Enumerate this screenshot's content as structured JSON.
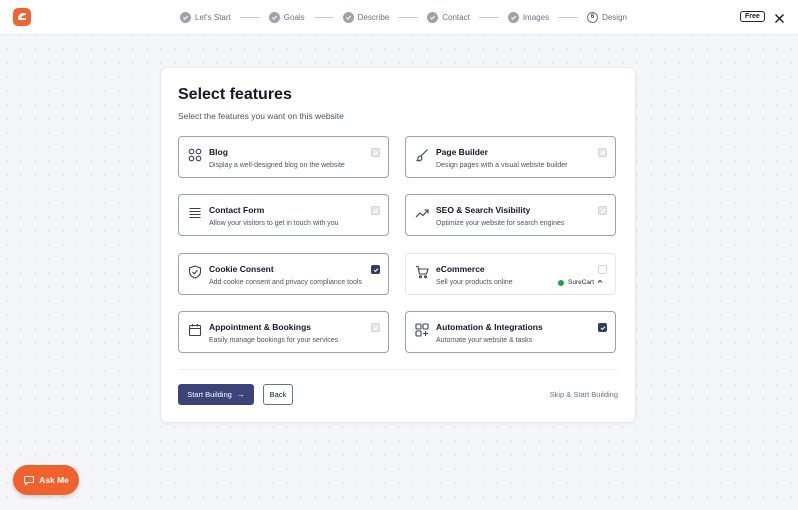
{
  "header": {
    "steps": [
      {
        "label": "Let's Start",
        "state": "done"
      },
      {
        "label": "Goals",
        "state": "done"
      },
      {
        "label": "Describe",
        "state": "done"
      },
      {
        "label": "Contact",
        "state": "done"
      },
      {
        "label": "Images",
        "state": "done"
      },
      {
        "label": "Design",
        "state": "current",
        "number": "6"
      }
    ],
    "badge": "Free"
  },
  "main": {
    "title": "Select features",
    "subtitle": "Select the features you want on this website",
    "features": [
      {
        "name": "Blog",
        "description": "Display a well-designed blog on the website",
        "icon": "grid-icon",
        "state": "locked"
      },
      {
        "name": "Page Builder",
        "description": "Design pages with a visual website builder",
        "icon": "brush-icon",
        "state": "locked"
      },
      {
        "name": "Contact Form",
        "description": "Allow your visitors to get in touch with you",
        "icon": "form-lines-icon",
        "state": "locked"
      },
      {
        "name": "SEO & Search Visibility",
        "description": "Optimize your website for search engines",
        "icon": "trend-up-icon",
        "state": "locked"
      },
      {
        "name": "Cookie Consent",
        "description": "Add cookie consent and privacy compliance tools",
        "icon": "shield-check-icon",
        "state": "checked"
      },
      {
        "name": "eCommerce",
        "description": "Sell your products online",
        "icon": "cart-icon",
        "state": "unchecked",
        "provider": "SureCart"
      },
      {
        "name": "Appointment & Bookings",
        "description": "Easily manage bookings for your services",
        "icon": "calendar-icon",
        "state": "locked"
      },
      {
        "name": "Automation & Integrations",
        "description": "Automate your website & tasks",
        "icon": "apps-plus-icon",
        "state": "checked"
      }
    ],
    "start_label": "Start Building",
    "back_label": "Back",
    "skip_label": "Skip & Start Building"
  },
  "assistant": {
    "label": "Ask Me"
  },
  "colors": {
    "brand": "#f2642d",
    "primary": "#3b4478",
    "checked": "#2f3d6b"
  }
}
